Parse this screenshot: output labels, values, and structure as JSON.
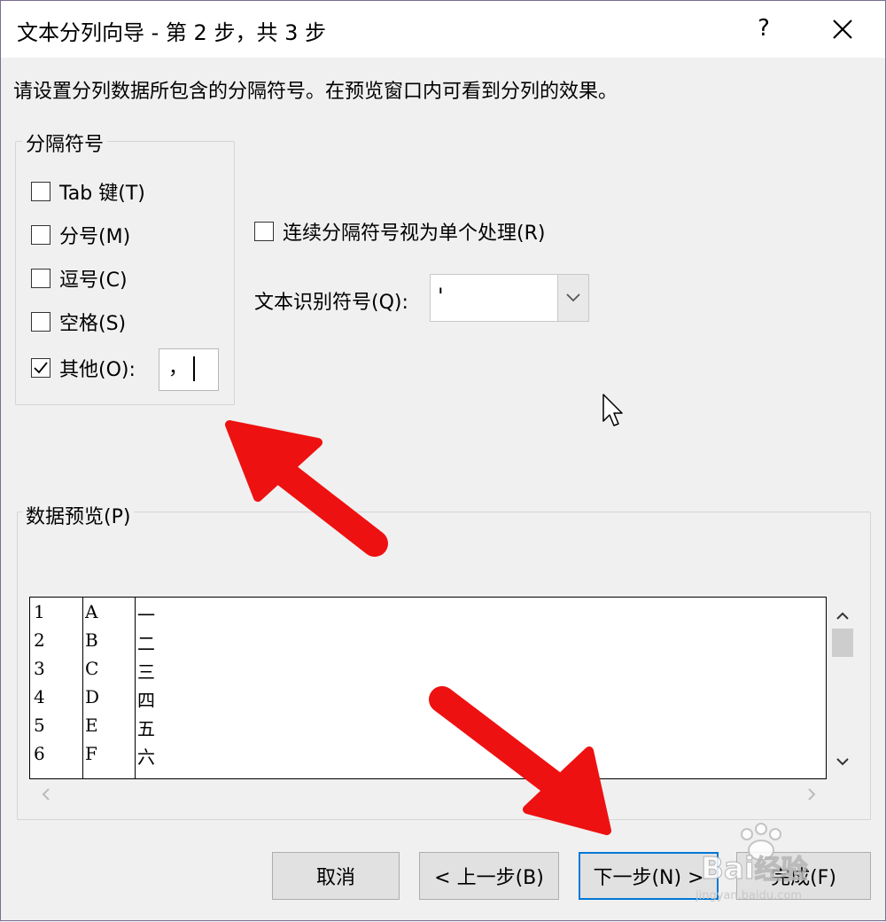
{
  "titlebar": {
    "title": "文本分列向导 - 第 2 步，共 3 步",
    "help_label": "?"
  },
  "description": "请设置分列数据所包含的分隔符号。在预览窗口内可看到分列的效果。",
  "delimiters": {
    "group_label": "分隔符号",
    "items": [
      {
        "label": "Tab 键(T)",
        "checked": false
      },
      {
        "label": "分号(M)",
        "checked": false
      },
      {
        "label": "逗号(C)",
        "checked": false
      },
      {
        "label": "空格(S)",
        "checked": false
      },
      {
        "label": "其他(O):",
        "checked": true
      }
    ],
    "other_value": "，"
  },
  "consecutive": {
    "label": "连续分隔符号视为单个处理(R)",
    "checked": false
  },
  "text_qualifier": {
    "label": "文本识别符号(Q):",
    "value": "'"
  },
  "preview": {
    "label": "数据预览(P)",
    "rows": [
      [
        "1",
        "A",
        "一"
      ],
      [
        "2",
        "B",
        "二"
      ],
      [
        "3",
        "C",
        "三"
      ],
      [
        "4",
        "D",
        "四"
      ],
      [
        "5",
        "E",
        "五"
      ],
      [
        "6",
        "F",
        "六"
      ]
    ]
  },
  "buttons": {
    "cancel": "取消",
    "back": "< 上一步(B)",
    "next": "下一步(N) >",
    "finish": "完成(F)"
  },
  "watermark": {
    "text": "Baidu经验",
    "url": "jingyan.baidu.com"
  },
  "colors": {
    "accent": "#0078d7",
    "annotation_arrow": "#ee1111"
  }
}
